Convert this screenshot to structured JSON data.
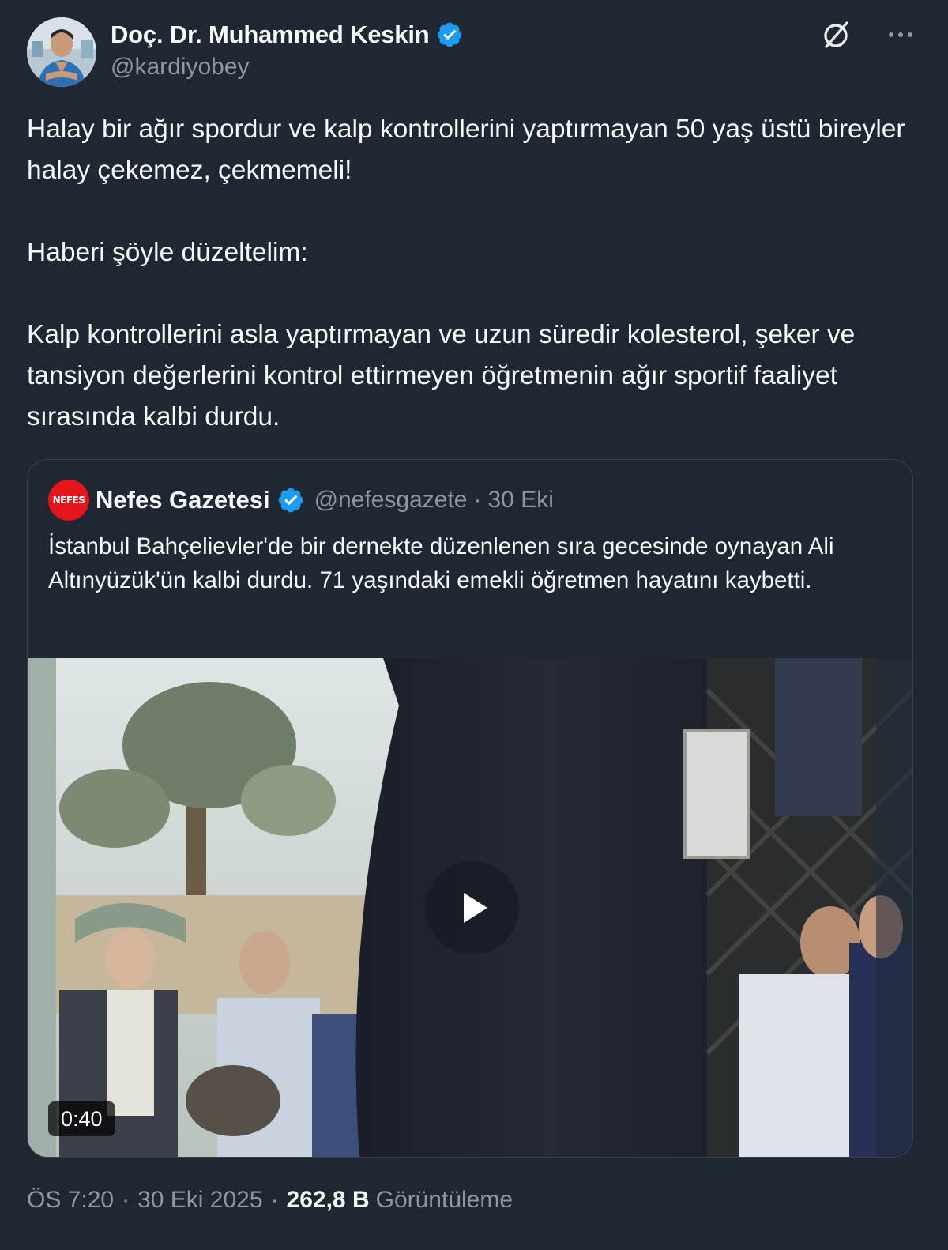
{
  "author": {
    "name": "Doç. Dr. Muhammed Keskin",
    "handle": "@kardiyobey",
    "verified": true
  },
  "icons": {
    "grok": "grok-icon",
    "more": "more-icon",
    "verified": "verified-badge-icon",
    "play": "play-icon"
  },
  "post": {
    "paragraphs": [
      "Halay bir ağır spordur ve kalp kontrollerini yaptırmayan 50 yaş üstü bireyler halay çekemez, çekmemeli!",
      "Haberi şöyle düzeltelim:",
      "Kalp kontrollerini asla yaptırmayan ve uzun süredir kolesterol, şeker ve tansiyon değerlerini kontrol ettirmeyen öğretmenin ağır sportif faaliyet sırasında kalbi durdu."
    ]
  },
  "quoted": {
    "logo_text": "NEFES",
    "name": "Nefes Gazetesi",
    "handle": "@nefesgazete",
    "dot": "·",
    "date": "30 Eki",
    "text": "İstanbul Bahçelievler'de bir dernekte düzenlenen sıra gecesinde oynayan Ali Altınyüzük'ün kalbi durdu. 71 yaşındaki emekli öğretmen hayatını kaybetti.",
    "video": {
      "duration": "0:40"
    }
  },
  "meta": {
    "time": "ÖS 7:20",
    "date": "30 Eki 2025",
    "sep": "·",
    "views_count": "262,8 B",
    "views_label": "Görüntüleme"
  },
  "colors": {
    "background": "#1e2732",
    "text": "#f7f9f9",
    "muted": "#8b98a5",
    "verified": "#1d9bf0",
    "border": "#38444d",
    "nefes_red": "#e5151c"
  }
}
